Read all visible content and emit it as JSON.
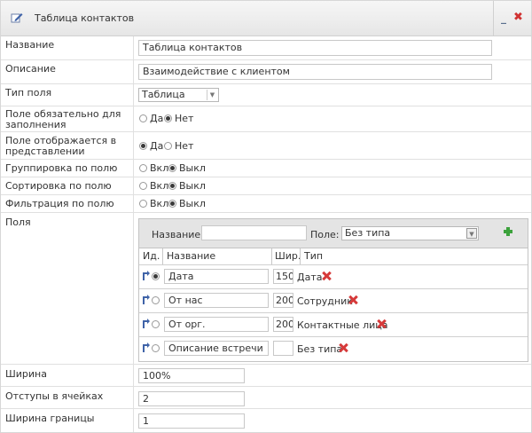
{
  "header": {
    "title": "Таблица контактов"
  },
  "form": {
    "name_label": "Название",
    "name_value": "Таблица контактов",
    "desc_label": "Описание",
    "desc_value": "Взаимодействие с клиентом",
    "fieldtype_label": "Тип поля",
    "fieldtype_value": "Таблица",
    "required_label": "Поле обязательно для заполнения",
    "shown_label": "Поле отображается в представлении",
    "yes": "Да",
    "no": "Нет",
    "grouping_label": "Группировка по полю",
    "sorting_label": "Сортировка по полю",
    "filter_label": "Фильтрация по полю",
    "on": "Вкл",
    "off": "Выкл",
    "fields_label": "Поля",
    "width_label": "Ширина",
    "width_value": "100%",
    "padding_label": "Отступы в ячейках",
    "padding_value": "2",
    "border_label": "Ширина границы",
    "border_value": "1"
  },
  "fields_editor": {
    "name_label": "Название:",
    "name_value": "",
    "field_label": "Поле:",
    "field_value": "Без типа",
    "columns": [
      "Ид.",
      "Название",
      "Шир.",
      "Тип"
    ],
    "rows": [
      {
        "name": "Дата",
        "width": "150",
        "type": "Дата",
        "selected": true
      },
      {
        "name": "От нас",
        "width": "200",
        "type": "Сотрудник",
        "selected": false
      },
      {
        "name": "От орг.",
        "width": "200",
        "type": "Контактные лица",
        "selected": false
      },
      {
        "name": "Описание встречи",
        "width": "",
        "type": "Без типа",
        "selected": false
      }
    ]
  },
  "colors": {
    "accent_close": "#d03232",
    "add_green": "#3ca23c",
    "delete_red": "#d63a3a"
  }
}
